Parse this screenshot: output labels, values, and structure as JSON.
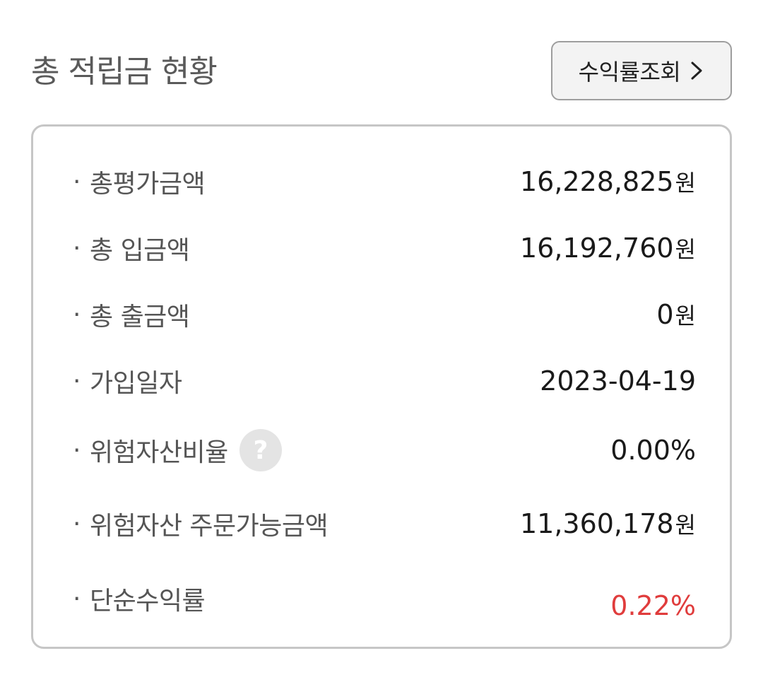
{
  "header": {
    "title": "총 적립금 현황",
    "yield_button_label": "수익률조회",
    "yield_button_icon": "chevron-right-icon"
  },
  "summary": {
    "bullet": "·",
    "unit": "원",
    "help_icon_glyph": "?",
    "rows": [
      {
        "label": "총평가금액",
        "value": "16,228,825",
        "unit": "원"
      },
      {
        "label": "총 입금액",
        "value": "16,192,760",
        "unit": "원"
      },
      {
        "label": "총 출금액",
        "value": "0",
        "unit": "원"
      },
      {
        "label": "가입일자",
        "value": "2023-04-19"
      },
      {
        "label": "위험자산비율",
        "value": "0.00%"
      },
      {
        "label": "위험자산 주문가능금액",
        "value": "11,360,178",
        "unit": "원"
      },
      {
        "label": "단순수익률",
        "value": "0.22%"
      }
    ]
  },
  "colors": {
    "positive_return": "#e03c3c",
    "border": "#c6c6c6",
    "button_bg": "#f3f3f3"
  }
}
